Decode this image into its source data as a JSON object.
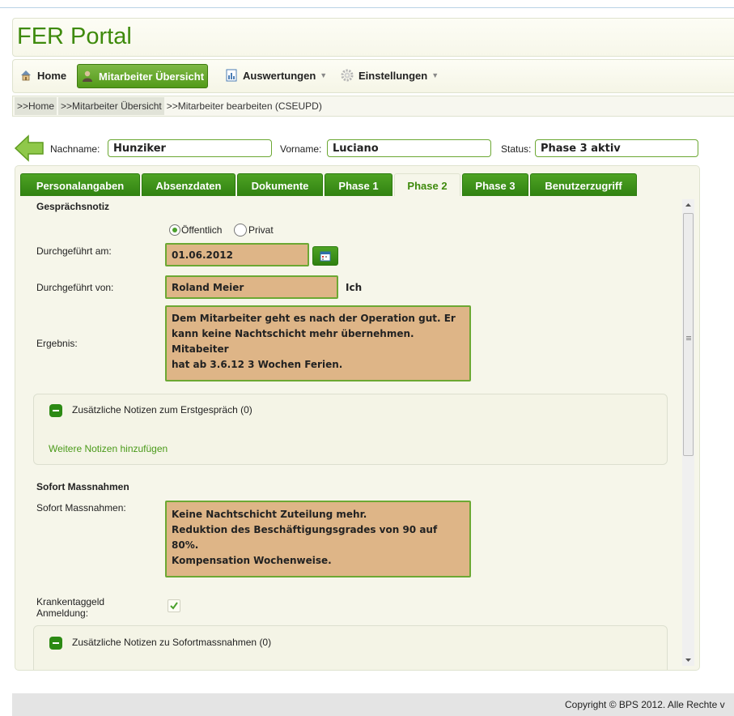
{
  "app": {
    "title": "FER Portal"
  },
  "menu": {
    "items": [
      {
        "label": "Home",
        "icon": "home-icon"
      },
      {
        "label": "Mitarbeiter Übersicht",
        "icon": "user-icon",
        "active": true
      },
      {
        "label": "Auswertungen",
        "icon": "report-icon",
        "dropdown": true
      },
      {
        "label": "Einstellungen",
        "icon": "gear-icon",
        "dropdown": true
      }
    ]
  },
  "breadcrumb": {
    "items": [
      ">>Home",
      ">>Mitarbeiter Übersicht"
    ],
    "current": ">>Mitarbeiter bearbeiten (CSEUPD)"
  },
  "header": {
    "nachname_label": "Nachname:",
    "nachname_value": "Hunziker",
    "vorname_label": "Vorname:",
    "vorname_value": "Luciano",
    "status_label": "Status:",
    "status_value": "Phase 3 aktiv"
  },
  "tabs": [
    {
      "label": "Personalangaben"
    },
    {
      "label": "Absenzdaten"
    },
    {
      "label": "Dokumente"
    },
    {
      "label": "Phase 1"
    },
    {
      "label": "Phase 2",
      "active": true
    },
    {
      "label": "Phase 3"
    },
    {
      "label": "Benutzerzugriff"
    }
  ],
  "form": {
    "gespraech_title": "Gesprächsnotiz",
    "visibility": {
      "option1": "Öffentlich",
      "option2": "Privat",
      "selected": "Öffentlich"
    },
    "durchgefuehrt_am_label": "Durchgeführt am:",
    "durchgefuehrt_am_value": "01.06.2012",
    "durchgefuehrt_von_label": "Durchgeführt von:",
    "durchgefuehrt_von_value": "Roland Meier",
    "ich_label": "Ich",
    "ergebnis_label": "Ergebnis:",
    "ergebnis_lines": [
      "Dem Mitarbeiter geht es nach der Operation gut. Er",
      "kann keine Nachtschicht mehr übernehmen. Mitabeiter",
      "hat ab 3.6.12 3 Wochen Ferien."
    ],
    "notes1_title": "Zusätzliche Notizen zum Erstgespräch (0)",
    "notes1_link": "Weitere Notizen hinzufügen",
    "sofort_title": "Sofort Massnahmen",
    "sofort_label": "Sofort Massnahmen:",
    "sofort_lines": [
      "Keine Nachtschicht Zuteilung mehr.",
      "Reduktion des Beschäftigungsgrades von 90 auf 80%.",
      "Kompensation Wochenweise."
    ],
    "kranken_label_line1": "Krankentaggeld",
    "kranken_label_line2": "Anmeldung:",
    "kranken_checked": true,
    "notes2_title": "Zusätzliche Notizen zu Sofortmassnahmen (0)"
  },
  "footer": {
    "copyright": "Copyright © BPS 2012. Alle Rechte v"
  },
  "colors": {
    "brand_green": "#3e8a0c",
    "tab_green": "#2f8010",
    "field_bg": "#deb587",
    "field_border": "#6ca833"
  }
}
